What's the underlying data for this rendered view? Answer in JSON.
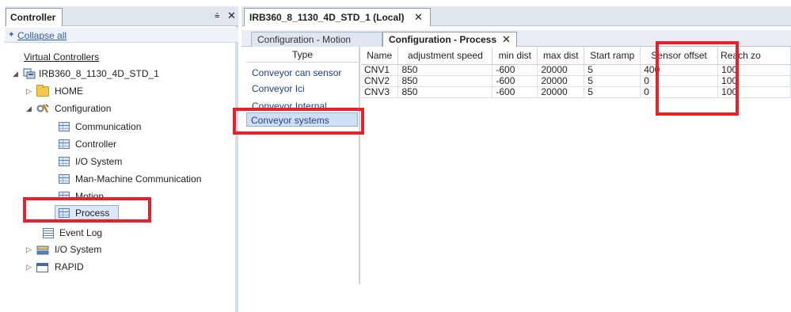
{
  "left_pane": {
    "tab_label": "Controller",
    "pin_icon": "pin-icon",
    "collapse_all": "Collapse all",
    "tree": {
      "virtual_controllers": "Virtual Controllers",
      "controller": "IRB360_8_1130_4D_STD_1",
      "home": "HOME",
      "configuration": "Configuration",
      "config_children": [
        "Communication",
        "Controller",
        "I/O System",
        "Man-Machine Communication",
        "Motion",
        "Process"
      ],
      "event_log": "Event Log",
      "io_system": "I/O System",
      "rapid": "RAPID"
    }
  },
  "document": {
    "tab_label": "IRB360_8_1130_4D_STD_1 (Local)",
    "sub_tabs": [
      {
        "label": "Configuration - Motion",
        "active": false
      },
      {
        "label": "Configuration - Process",
        "active": true
      }
    ]
  },
  "type_list": {
    "header": "Type",
    "items": [
      "Conveyor can sensor",
      "Conveyor Ici",
      "Conveyor Internal",
      "Conveyor systems"
    ],
    "selected": "Conveyor systems"
  },
  "grid": {
    "columns": [
      "Name",
      "adjustment speed",
      "min dist",
      "max dist",
      "Start ramp",
      "Sensor offset",
      "Reach zo"
    ],
    "rows": [
      [
        "CNV1",
        "850",
        "-600",
        "20000",
        "5",
        "400",
        "100"
      ],
      [
        "CNV2",
        "850",
        "-600",
        "20000",
        "5",
        "0",
        "100"
      ],
      [
        "CNV3",
        "850",
        "-600",
        "20000",
        "5",
        "0",
        "100"
      ]
    ]
  },
  "colors": {
    "highlight": "#e8202a",
    "link": "#2f5ea8"
  }
}
